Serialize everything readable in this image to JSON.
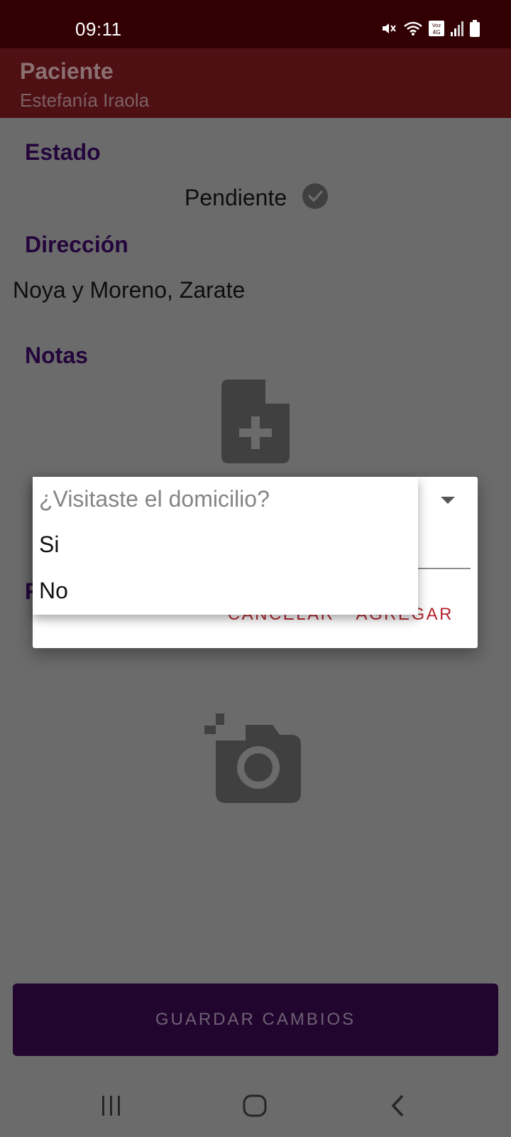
{
  "status_bar": {
    "time": "09:11",
    "icons": [
      "mute-icon",
      "wifi-icon",
      "volte-4g-icon",
      "signal-icon",
      "battery-icon"
    ]
  },
  "app_bar": {
    "title": "Paciente",
    "subtitle": "Estefanía Iraola"
  },
  "sections": {
    "estado_heading": "Estado",
    "estado_value": "Pendiente",
    "direccion_heading": "Dirección",
    "direccion_value": "Noya y Moreno, Zarate",
    "notas_heading": "Notas",
    "fotos_heading_partial": "F"
  },
  "dialog": {
    "actions": {
      "cancel": "CANCELAR",
      "add": "AGREGAR"
    }
  },
  "dropdown_popup": {
    "hint": "¿Visitaste el domicilio?",
    "options": [
      "Si",
      "No"
    ]
  },
  "save_button": {
    "label": "GUARDAR CAMBIOS"
  },
  "colors": {
    "status_bar": "#320003",
    "app_bar": "#4f1014",
    "heading": "#23053c",
    "accent": "#b3242b",
    "button": "#22052f"
  }
}
